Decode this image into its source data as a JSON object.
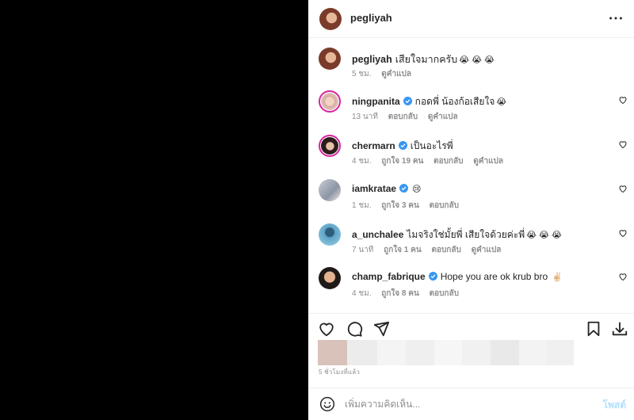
{
  "post": {
    "username": "pegliyah"
  },
  "caption": {
    "username": "pegliyah",
    "text": "เสียใจมากครับ",
    "emojis": "😭 😭 😭",
    "time": "5 ชม.",
    "translate": "ดูคำแปล"
  },
  "comments": [
    {
      "username": "ningpanita",
      "verified": true,
      "text": "กอดพี่ น้องก้อเสียใจ",
      "emojis": "😭",
      "time": "13 นาที",
      "likes": "",
      "reply": "ตอบกลับ",
      "translate": "ดูคำแปล"
    },
    {
      "username": "chermarn",
      "verified": true,
      "text": "เป็นอะไรพี่",
      "emojis": "",
      "time": "4 ชม.",
      "likes": "ถูกใจ 19 คน",
      "reply": "ตอบกลับ",
      "translate": "ดูคำแปล"
    },
    {
      "username": "iamkratae",
      "verified": true,
      "text": "",
      "emojis": "😢",
      "time": "1 ชม.",
      "likes": "ถูกใจ 3 คน",
      "reply": "ตอบกลับ",
      "translate": ""
    },
    {
      "username": "a_unchalee",
      "verified": false,
      "text": "ไมจริงใช่มั้ยพี่ เสียใจด้วยค่ะพี่",
      "emojis": "😭 😭 😭",
      "time": "7 นาที",
      "likes": "ถูกใจ 1 คน",
      "reply": "ตอบกลับ",
      "translate": "ดูคำแปล"
    },
    {
      "username": "champ_fabrique",
      "verified": true,
      "text": "Hope you are ok krub bro",
      "emojis": "✌🏻",
      "time": "4 ชม.",
      "likes": "ถูกใจ 8 คน",
      "reply": "ตอบกลับ",
      "translate": ""
    }
  ],
  "footer": {
    "time_ago": "5 ชั่วโมงที่แล้ว"
  },
  "compose": {
    "placeholder": "เพิ่มความคิดเห็น...",
    "post_label": "โพสต์"
  },
  "colors": {
    "accent_disabled": "#b2dffc",
    "verified": "#3897f0",
    "muted_text": "#8e8e8e"
  }
}
